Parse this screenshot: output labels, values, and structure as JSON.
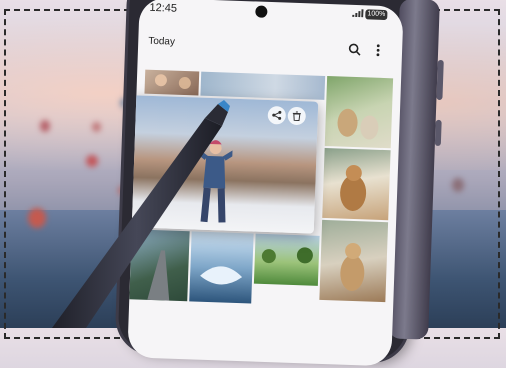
{
  "status_bar": {
    "time": "12:45",
    "battery": "100%"
  },
  "gallery": {
    "title": "Today",
    "icons": {
      "search": "search-icon",
      "more": "more-vertical-icon",
      "share": "share-icon",
      "delete": "trash-icon"
    }
  },
  "colors": {
    "pen_body": "#2c2d38",
    "pen_tip": "#3a86c8",
    "phone_frame": "#2b2a33"
  }
}
